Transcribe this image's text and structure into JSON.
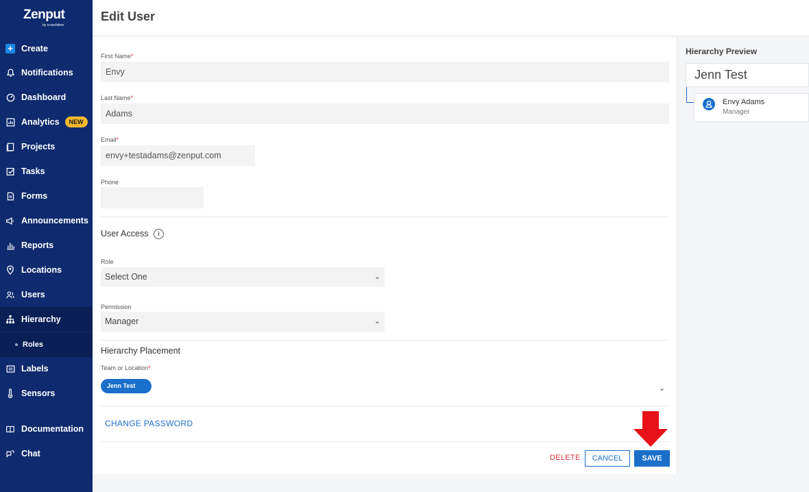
{
  "app": {
    "logo": "Zenput",
    "logo_sub": "by crunchtime"
  },
  "sidebar": {
    "items": [
      {
        "label": "Create"
      },
      {
        "label": "Notifications"
      },
      {
        "label": "Dashboard"
      },
      {
        "label": "Analytics",
        "badge": "NEW"
      },
      {
        "label": "Projects"
      },
      {
        "label": "Tasks"
      },
      {
        "label": "Forms"
      },
      {
        "label": "Announcements"
      },
      {
        "label": "Reports"
      },
      {
        "label": "Locations"
      },
      {
        "label": "Users"
      },
      {
        "label": "Hierarchy"
      },
      {
        "label": "Roles"
      },
      {
        "label": "Labels"
      },
      {
        "label": "Sensors"
      },
      {
        "label": "Documentation"
      },
      {
        "label": "Chat"
      }
    ],
    "active": "Hierarchy"
  },
  "header": {
    "title": "Edit User"
  },
  "form": {
    "first_name": {
      "label": "First Name",
      "required": "*",
      "value": "Envy"
    },
    "last_name": {
      "label": "Last Name",
      "required": "*",
      "value": "Adams"
    },
    "email": {
      "label": "Email",
      "required": "*",
      "value": "envy+testadams@zenput.com"
    },
    "phone": {
      "label": "Phone",
      "value": ""
    },
    "user_access": {
      "title": "User Access",
      "info": "i",
      "role": {
        "label": "Role",
        "value": "Select One"
      },
      "permission": {
        "label": "Permission",
        "value": "Manager"
      }
    },
    "hierarchy_placement": {
      "title": "Hierarchy Placement",
      "team_label": "Team or Location",
      "required": "*",
      "chip": "Jenn Test"
    },
    "change_password": "CHANGE PASSWORD",
    "actions": {
      "delete": "DELETE",
      "cancel": "CANCEL",
      "save": "SAVE"
    }
  },
  "preview": {
    "title": "Hierarchy Preview",
    "root": "Jenn Test",
    "child_name": "Envy Adams",
    "child_role": "Manager"
  },
  "colors": {
    "sidebar_bg": "#0f2a6e",
    "primary": "#1a6fcb",
    "danger": "#d9363e",
    "badge": "#f5b82e",
    "annotation_arrow": "#e8101a"
  }
}
